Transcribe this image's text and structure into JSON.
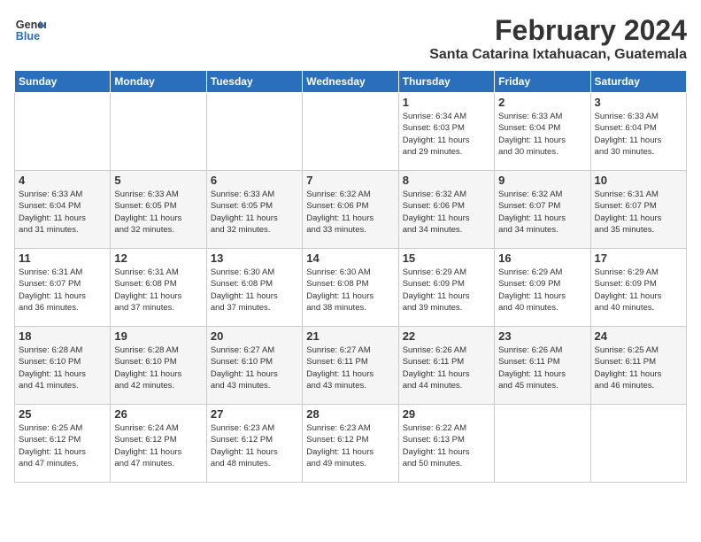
{
  "header": {
    "logo_line1": "General",
    "logo_line2": "Blue",
    "month_title": "February 2024",
    "subtitle": "Santa Catarina Ixtahuacan, Guatemala"
  },
  "days_of_week": [
    "Sunday",
    "Monday",
    "Tuesday",
    "Wednesday",
    "Thursday",
    "Friday",
    "Saturday"
  ],
  "weeks": [
    [
      {
        "day": "",
        "info": ""
      },
      {
        "day": "",
        "info": ""
      },
      {
        "day": "",
        "info": ""
      },
      {
        "day": "",
        "info": ""
      },
      {
        "day": "1",
        "info": "Sunrise: 6:34 AM\nSunset: 6:03 PM\nDaylight: 11 hours\nand 29 minutes."
      },
      {
        "day": "2",
        "info": "Sunrise: 6:33 AM\nSunset: 6:04 PM\nDaylight: 11 hours\nand 30 minutes."
      },
      {
        "day": "3",
        "info": "Sunrise: 6:33 AM\nSunset: 6:04 PM\nDaylight: 11 hours\nand 30 minutes."
      }
    ],
    [
      {
        "day": "4",
        "info": "Sunrise: 6:33 AM\nSunset: 6:04 PM\nDaylight: 11 hours\nand 31 minutes."
      },
      {
        "day": "5",
        "info": "Sunrise: 6:33 AM\nSunset: 6:05 PM\nDaylight: 11 hours\nand 32 minutes."
      },
      {
        "day": "6",
        "info": "Sunrise: 6:33 AM\nSunset: 6:05 PM\nDaylight: 11 hours\nand 32 minutes."
      },
      {
        "day": "7",
        "info": "Sunrise: 6:32 AM\nSunset: 6:06 PM\nDaylight: 11 hours\nand 33 minutes."
      },
      {
        "day": "8",
        "info": "Sunrise: 6:32 AM\nSunset: 6:06 PM\nDaylight: 11 hours\nand 34 minutes."
      },
      {
        "day": "9",
        "info": "Sunrise: 6:32 AM\nSunset: 6:07 PM\nDaylight: 11 hours\nand 34 minutes."
      },
      {
        "day": "10",
        "info": "Sunrise: 6:31 AM\nSunset: 6:07 PM\nDaylight: 11 hours\nand 35 minutes."
      }
    ],
    [
      {
        "day": "11",
        "info": "Sunrise: 6:31 AM\nSunset: 6:07 PM\nDaylight: 11 hours\nand 36 minutes."
      },
      {
        "day": "12",
        "info": "Sunrise: 6:31 AM\nSunset: 6:08 PM\nDaylight: 11 hours\nand 37 minutes."
      },
      {
        "day": "13",
        "info": "Sunrise: 6:30 AM\nSunset: 6:08 PM\nDaylight: 11 hours\nand 37 minutes."
      },
      {
        "day": "14",
        "info": "Sunrise: 6:30 AM\nSunset: 6:08 PM\nDaylight: 11 hours\nand 38 minutes."
      },
      {
        "day": "15",
        "info": "Sunrise: 6:29 AM\nSunset: 6:09 PM\nDaylight: 11 hours\nand 39 minutes."
      },
      {
        "day": "16",
        "info": "Sunrise: 6:29 AM\nSunset: 6:09 PM\nDaylight: 11 hours\nand 40 minutes."
      },
      {
        "day": "17",
        "info": "Sunrise: 6:29 AM\nSunset: 6:09 PM\nDaylight: 11 hours\nand 40 minutes."
      }
    ],
    [
      {
        "day": "18",
        "info": "Sunrise: 6:28 AM\nSunset: 6:10 PM\nDaylight: 11 hours\nand 41 minutes."
      },
      {
        "day": "19",
        "info": "Sunrise: 6:28 AM\nSunset: 6:10 PM\nDaylight: 11 hours\nand 42 minutes."
      },
      {
        "day": "20",
        "info": "Sunrise: 6:27 AM\nSunset: 6:10 PM\nDaylight: 11 hours\nand 43 minutes."
      },
      {
        "day": "21",
        "info": "Sunrise: 6:27 AM\nSunset: 6:11 PM\nDaylight: 11 hours\nand 43 minutes."
      },
      {
        "day": "22",
        "info": "Sunrise: 6:26 AM\nSunset: 6:11 PM\nDaylight: 11 hours\nand 44 minutes."
      },
      {
        "day": "23",
        "info": "Sunrise: 6:26 AM\nSunset: 6:11 PM\nDaylight: 11 hours\nand 45 minutes."
      },
      {
        "day": "24",
        "info": "Sunrise: 6:25 AM\nSunset: 6:11 PM\nDaylight: 11 hours\nand 46 minutes."
      }
    ],
    [
      {
        "day": "25",
        "info": "Sunrise: 6:25 AM\nSunset: 6:12 PM\nDaylight: 11 hours\nand 47 minutes."
      },
      {
        "day": "26",
        "info": "Sunrise: 6:24 AM\nSunset: 6:12 PM\nDaylight: 11 hours\nand 47 minutes."
      },
      {
        "day": "27",
        "info": "Sunrise: 6:23 AM\nSunset: 6:12 PM\nDaylight: 11 hours\nand 48 minutes."
      },
      {
        "day": "28",
        "info": "Sunrise: 6:23 AM\nSunset: 6:12 PM\nDaylight: 11 hours\nand 49 minutes."
      },
      {
        "day": "29",
        "info": "Sunrise: 6:22 AM\nSunset: 6:13 PM\nDaylight: 11 hours\nand 50 minutes."
      },
      {
        "day": "",
        "info": ""
      },
      {
        "day": "",
        "info": ""
      }
    ]
  ]
}
